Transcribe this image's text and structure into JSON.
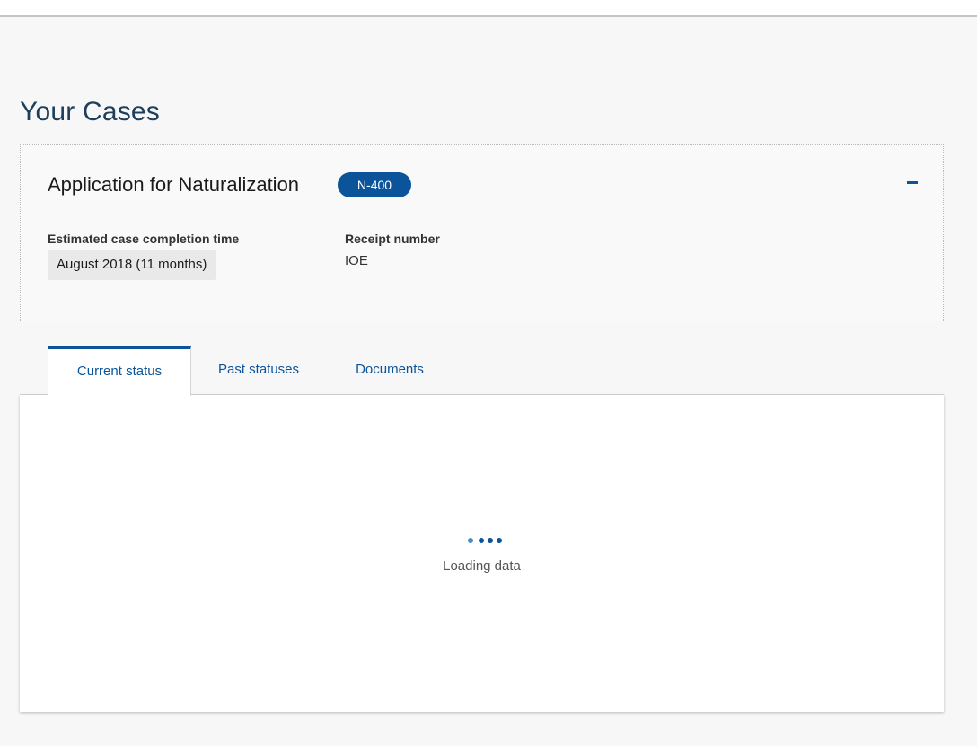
{
  "page": {
    "title": "Your Cases"
  },
  "case": {
    "title": "Application for Naturalization",
    "form_badge": "N-400",
    "collapse_icon": "minus-icon",
    "completion": {
      "label": "Estimated case completion time",
      "value": "August 2018 (11 months)"
    },
    "receipt": {
      "label": "Receipt number",
      "value": "IOE"
    }
  },
  "tabs": [
    {
      "label": "Current status",
      "active": true
    },
    {
      "label": "Past statuses",
      "active": false
    },
    {
      "label": "Documents",
      "active": false
    }
  ],
  "panel": {
    "loader_icon": "loading-dots-icon",
    "loading_text": "Loading data"
  },
  "colors": {
    "accent": "#0b5499",
    "title": "#1d3e5c",
    "background": "#f7f7f7"
  }
}
